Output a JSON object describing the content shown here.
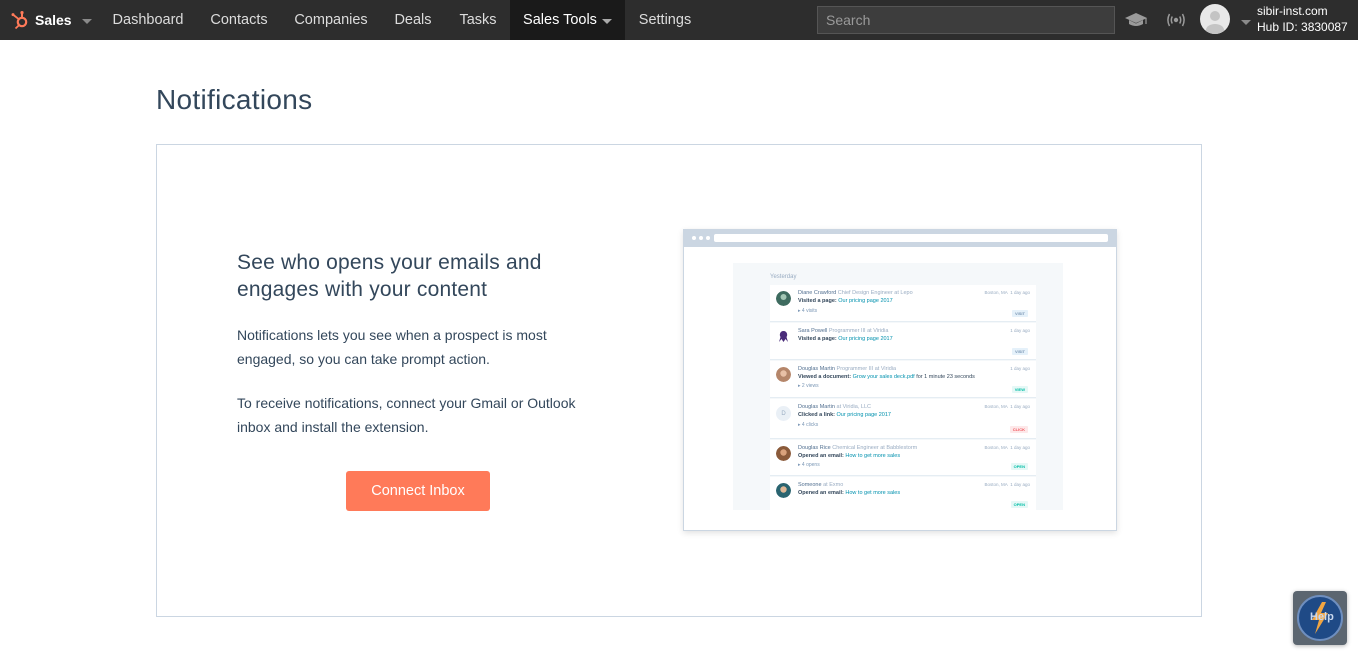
{
  "colors": {
    "nav_bg": "#2d2d2d",
    "nav_active_bg": "#1a1a1a",
    "brand_orange": "#ff7a59",
    "text_primary": "#33475b",
    "border": "#cbd6e2",
    "link": "#0091ae"
  },
  "nav": {
    "brand": "Sales",
    "items": [
      {
        "label": "Dashboard"
      },
      {
        "label": "Contacts"
      },
      {
        "label": "Companies"
      },
      {
        "label": "Deals"
      },
      {
        "label": "Tasks"
      },
      {
        "label": "Sales Tools",
        "active": true
      },
      {
        "label": "Settings"
      }
    ],
    "search_placeholder": "Search",
    "icons": [
      "academy-icon",
      "broadcast-icon"
    ],
    "account": {
      "domain": "sibir-inst.com",
      "hub_id": "Hub ID: 3830087"
    }
  },
  "page": {
    "title": "Notifications",
    "headline": "See who opens your emails and engages with your content",
    "paragraph_1": "Notifications lets you see when a prospect is most engaged, so you can take prompt action.",
    "paragraph_2": "To receive notifications, connect your Gmail or Outlook inbox and install the extension.",
    "cta_label": "Connect Inbox"
  },
  "illustration": {
    "day_label": "Yesterday",
    "items": [
      {
        "name": "Diane Crawford",
        "role": "Chief Design Engineer at Lepo",
        "action_label": "Visited a page:",
        "action_link": "Our pricing page 2017",
        "count": "4 visits",
        "location": "Boston, MA",
        "time": "1 day ago",
        "tag": "VISIT"
      },
      {
        "name": "Sara Powell",
        "role": "Programmer III at Viridia",
        "action_label": "Visited a page:",
        "action_link": "Our pricing page 2017",
        "count": "",
        "location": "",
        "time": "1 day ago",
        "tag": "VISIT"
      },
      {
        "name": "Douglas Martin",
        "role": "Programmer III at Viridia",
        "action_label": "Viewed a document:",
        "action_link": "Grow your sales deck.pdf",
        "action_suffix": "for 1 minute 23 seconds",
        "count": "2 views",
        "location": "",
        "time": "1 day ago",
        "tag": "VIEW"
      },
      {
        "name": "Douglas Martin",
        "role": "at Viridia, LLC",
        "action_label": "Clicked a link:",
        "action_link": "Our pricing page 2017",
        "count": "4 clicks",
        "location": "Boston, MA",
        "time": "1 day ago",
        "tag": "CLICK"
      },
      {
        "name": "Douglas Rice",
        "role": "Chemical Engineer at Babblestorm",
        "action_label": "Opened an email:",
        "action_link": "How to get more sales",
        "count": "4 opens",
        "location": "Boston, MA",
        "time": "1 day ago",
        "tag": "OPEN"
      },
      {
        "name": "Someone",
        "role": "at Exmo",
        "action_label": "Opened an email:",
        "action_link": "How to get more sales",
        "count": "",
        "location": "Boston, MA",
        "time": "1 day ago",
        "tag": "OPEN"
      }
    ]
  },
  "help_widget": {
    "label": "Help"
  }
}
